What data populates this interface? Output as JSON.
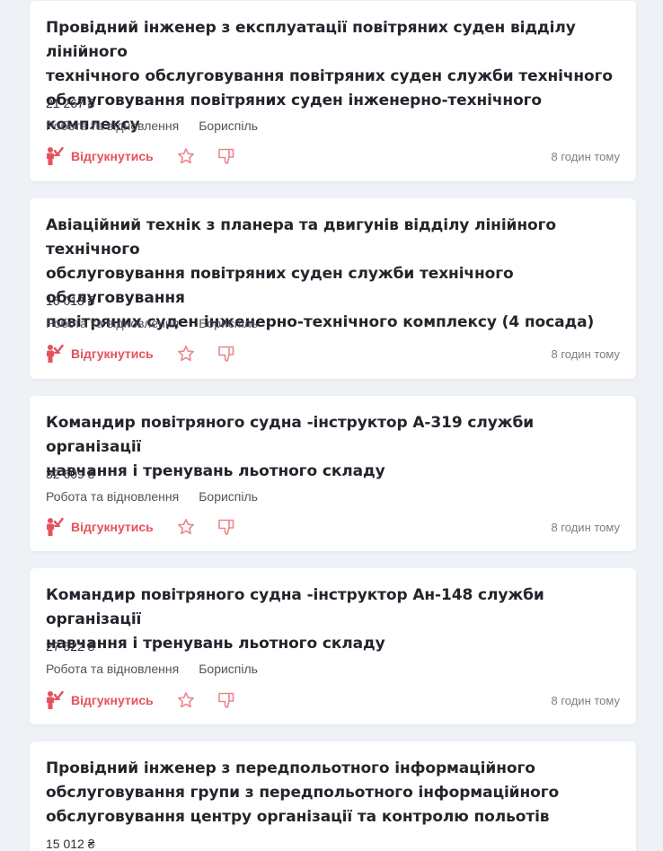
{
  "colors": {
    "background": "#eef1f5",
    "card": "#ffffff",
    "accent": "#e5525a",
    "icon": "#e9878c"
  },
  "icons": {
    "apply": "respond-hand-icon",
    "favorite": "star-outline-icon",
    "dislike": "thumbs-down-icon"
  },
  "jobs": [
    {
      "title_lines": [
        "Провідний інженер з експлуатації повітряних суден відділу лінійного",
        "технічного обслуговування повітряних суден служби технічного",
        "обслуговування повітряних суден інженерно-технічного комплексу"
      ],
      "salary": "21 267 ₴",
      "category": "Робота та відновлення",
      "city": "Бориспіль",
      "apply_label": "Відгукнутись",
      "posted": "8 годин тому"
    },
    {
      "title_lines": [
        "Авіаційний технік з планера та двигунів відділу лінійного технічного",
        "обслуговування повітряних суден служби технічного обслуговування",
        "повітряних суден інженерно-технічного комплексу (4 посада)"
      ],
      "salary": "16 013 ₴",
      "category": "Робота та відновлення",
      "city": "Бориспіль",
      "apply_label": "Відгукнутись",
      "posted": "8 годин тому"
    },
    {
      "title_lines": [
        "Командир повітряного судна -інструктор А-319 служби організації",
        "навчання і тренувань льотного складу"
      ],
      "salary": "32 609 ₴",
      "category": "Робота та відновлення",
      "city": "Бориспіль",
      "apply_label": "Відгукнутись",
      "posted": "8 годин тому"
    },
    {
      "title_lines": [
        "Командир повітряного судна -інструктор Ан-148 служби організації",
        "навчання і тренувань льотного складу"
      ],
      "salary": "27 522 ₴",
      "category": "Робота та відновлення",
      "city": "Бориспіль",
      "apply_label": "Відгукнутись",
      "posted": "8 годин тому"
    },
    {
      "title_lines": [
        "Провідний інженер з передпольотного інформаційного",
        "обслуговування групи з передпольотного інформаційного",
        "обслуговування центру організації та контролю польотів"
      ],
      "salary": "15 012 ₴",
      "category": "",
      "city": "",
      "apply_label": "",
      "posted": ""
    }
  ]
}
